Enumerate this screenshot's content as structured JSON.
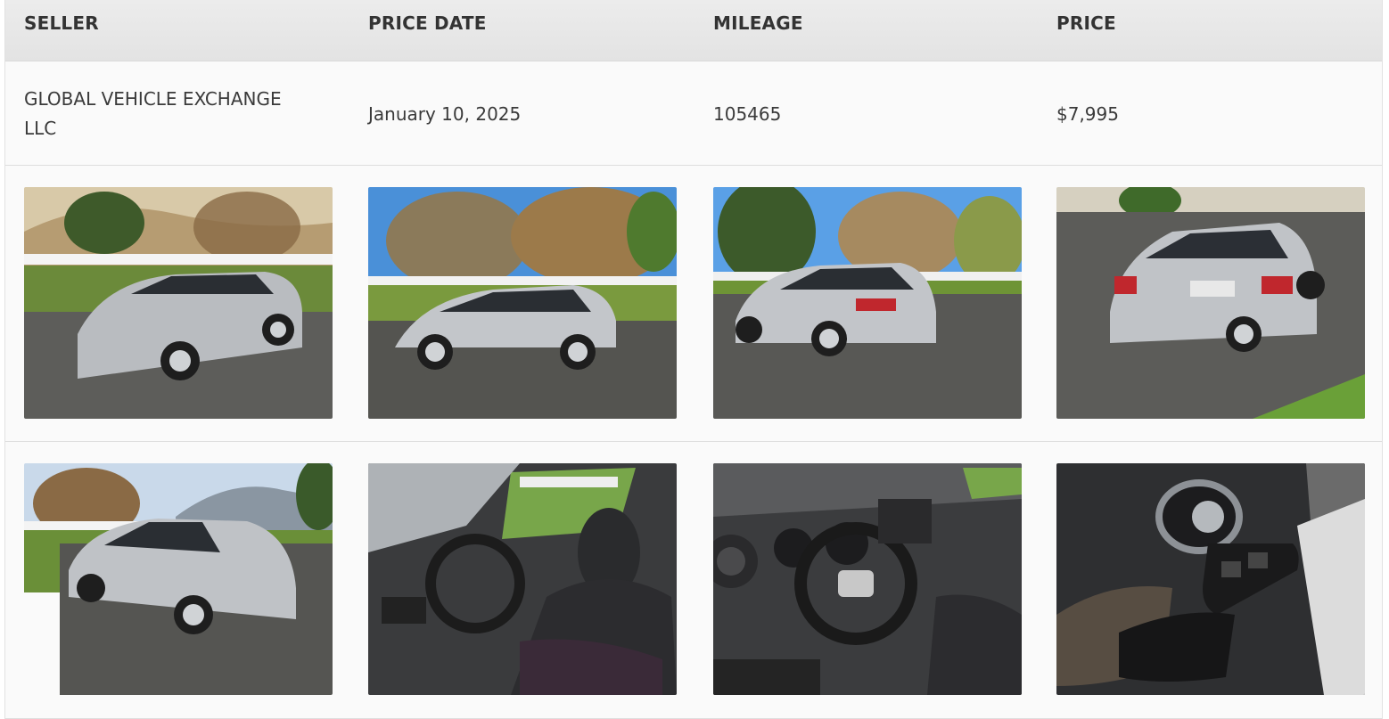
{
  "table": {
    "headers": {
      "seller": "SELLER",
      "price_date": "PRICE DATE",
      "mileage": "MILEAGE",
      "price": "PRICE"
    },
    "row": {
      "seller": "GLOBAL VEHICLE EXCHANGE LLC",
      "price_date": "January 10, 2025",
      "mileage": "105465",
      "price": "$7,995"
    }
  },
  "photos": [
    {
      "icon": "car-exterior-front-left-photo"
    },
    {
      "icon": "car-exterior-side-left-photo"
    },
    {
      "icon": "car-exterior-rear-left-photo"
    },
    {
      "icon": "car-exterior-rear-right-photo"
    },
    {
      "icon": "car-exterior-front-right-photo"
    },
    {
      "icon": "car-interior-front-seats-photo"
    },
    {
      "icon": "car-interior-dashboard-photo"
    },
    {
      "icon": "car-interior-door-panel-photo"
    }
  ],
  "colors": {
    "header_bg": "#e6e6e6",
    "row_bg": "#fafafa",
    "border": "#dedede",
    "text": "#333333"
  }
}
